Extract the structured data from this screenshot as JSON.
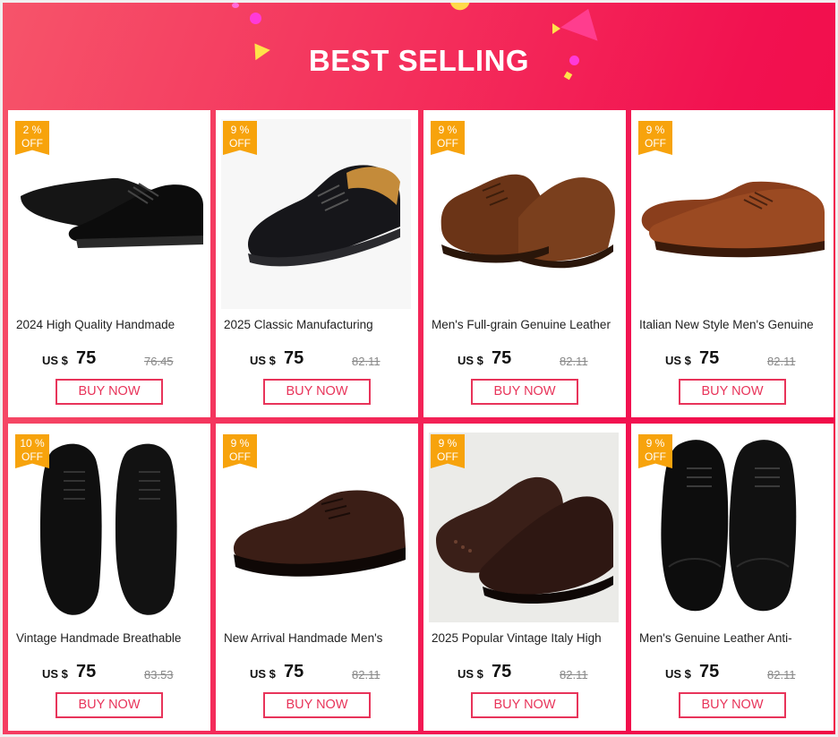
{
  "header": {
    "title": "BEST SELLING"
  },
  "theme": {
    "accent": "#f0154d",
    "badge": "#f7a30c",
    "button_border": "#e8345a"
  },
  "products": [
    {
      "name": "2024 High Quality Handmade",
      "discount": "2  %",
      "off": "OFF",
      "currency": "US $",
      "price": "75",
      "old_price": "76.45",
      "cta": "BUY NOW",
      "image": "black-oxford-shoe"
    },
    {
      "name": "2025 Classic Manufacturing",
      "discount": "9  %",
      "off": "OFF",
      "currency": "US $",
      "price": "75",
      "old_price": "82.11",
      "cta": "BUY NOW",
      "image": "black-cap-toe-oxford"
    },
    {
      "name": "Men's Full-grain Genuine Leather",
      "discount": "9  %",
      "off": "OFF",
      "currency": "US $",
      "price": "75",
      "old_price": "82.11",
      "cta": "BUY NOW",
      "image": "brown-brogue-derby"
    },
    {
      "name": "Italian New Style Men's Genuine",
      "discount": "9  %",
      "off": "OFF",
      "currency": "US $",
      "price": "75",
      "old_price": "82.11",
      "cta": "BUY NOW",
      "image": "brown-cap-toe-oxford"
    },
    {
      "name": "Vintage Handmade Breathable",
      "discount": "10  %",
      "off": "OFF",
      "currency": "US $",
      "price": "75",
      "old_price": "83.53",
      "cta": "BUY NOW",
      "image": "black-square-toe-pair"
    },
    {
      "name": "New Arrival Handmade Men's",
      "discount": "9  %",
      "off": "OFF",
      "currency": "US $",
      "price": "75",
      "old_price": "82.11",
      "cta": "BUY NOW",
      "image": "dark-brown-derby"
    },
    {
      "name": "2025 Popular Vintage Italy High",
      "discount": "9  %",
      "off": "OFF",
      "currency": "US $",
      "price": "75",
      "old_price": "82.11",
      "cta": "BUY NOW",
      "image": "dark-brown-brogue-pair"
    },
    {
      "name": "Men's Genuine Leather Anti-",
      "discount": "9  %",
      "off": "OFF",
      "currency": "US $",
      "price": "75",
      "old_price": "82.11",
      "cta": "BUY NOW",
      "image": "black-wingtip-pair"
    }
  ]
}
